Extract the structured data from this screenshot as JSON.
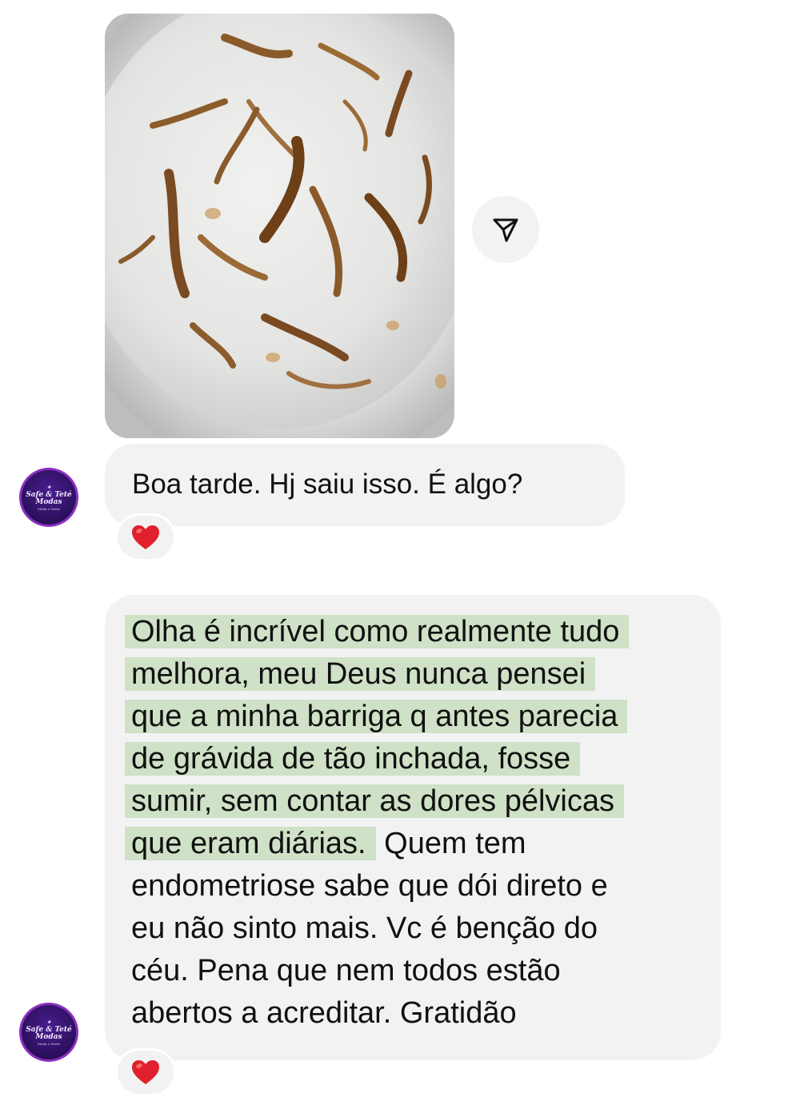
{
  "thread": {
    "photo": {
      "alt_subject": "plate-with-brown-residue"
    },
    "share_icon": "paper-plane-icon",
    "messages": [
      {
        "sender_avatar": {
          "line1": "Safe & Teté",
          "line2": "Modas",
          "line3": "Moda e Vestir",
          "icon": "sparkle-icon"
        },
        "text": "Boa tarde. Hj saiu isso. É algo?",
        "reaction": "❤️"
      },
      {
        "sender_avatar": {
          "line1": "Safe & Teté",
          "line2": "Modas",
          "line3": "Moda e Vestir",
          "icon": "sparkle-icon"
        },
        "lines": [
          "Olha é incrível como realmente tudo",
          "melhora, meu Deus nunca pensei",
          "que a minha barriga q antes parecia",
          "de grávida de tão inchada, fosse",
          "sumir, sem contar as dores pélvicas",
          "que eram diárias.",
          " Quem tem",
          "endometriose sabe que dói direto e",
          "eu não sinto mais. Vc é benção do",
          "céu. Pena que nem todos estão",
          "abertos a acreditar. Gratidão"
        ],
        "highlight_color": "#cfe1c6",
        "reaction": "❤️"
      }
    ],
    "colors": {
      "bubble": "#f2f2f3",
      "highlight": "#cfe1c6",
      "heart": "#e0202c",
      "avatar_ring": "#8a2fbf"
    }
  }
}
